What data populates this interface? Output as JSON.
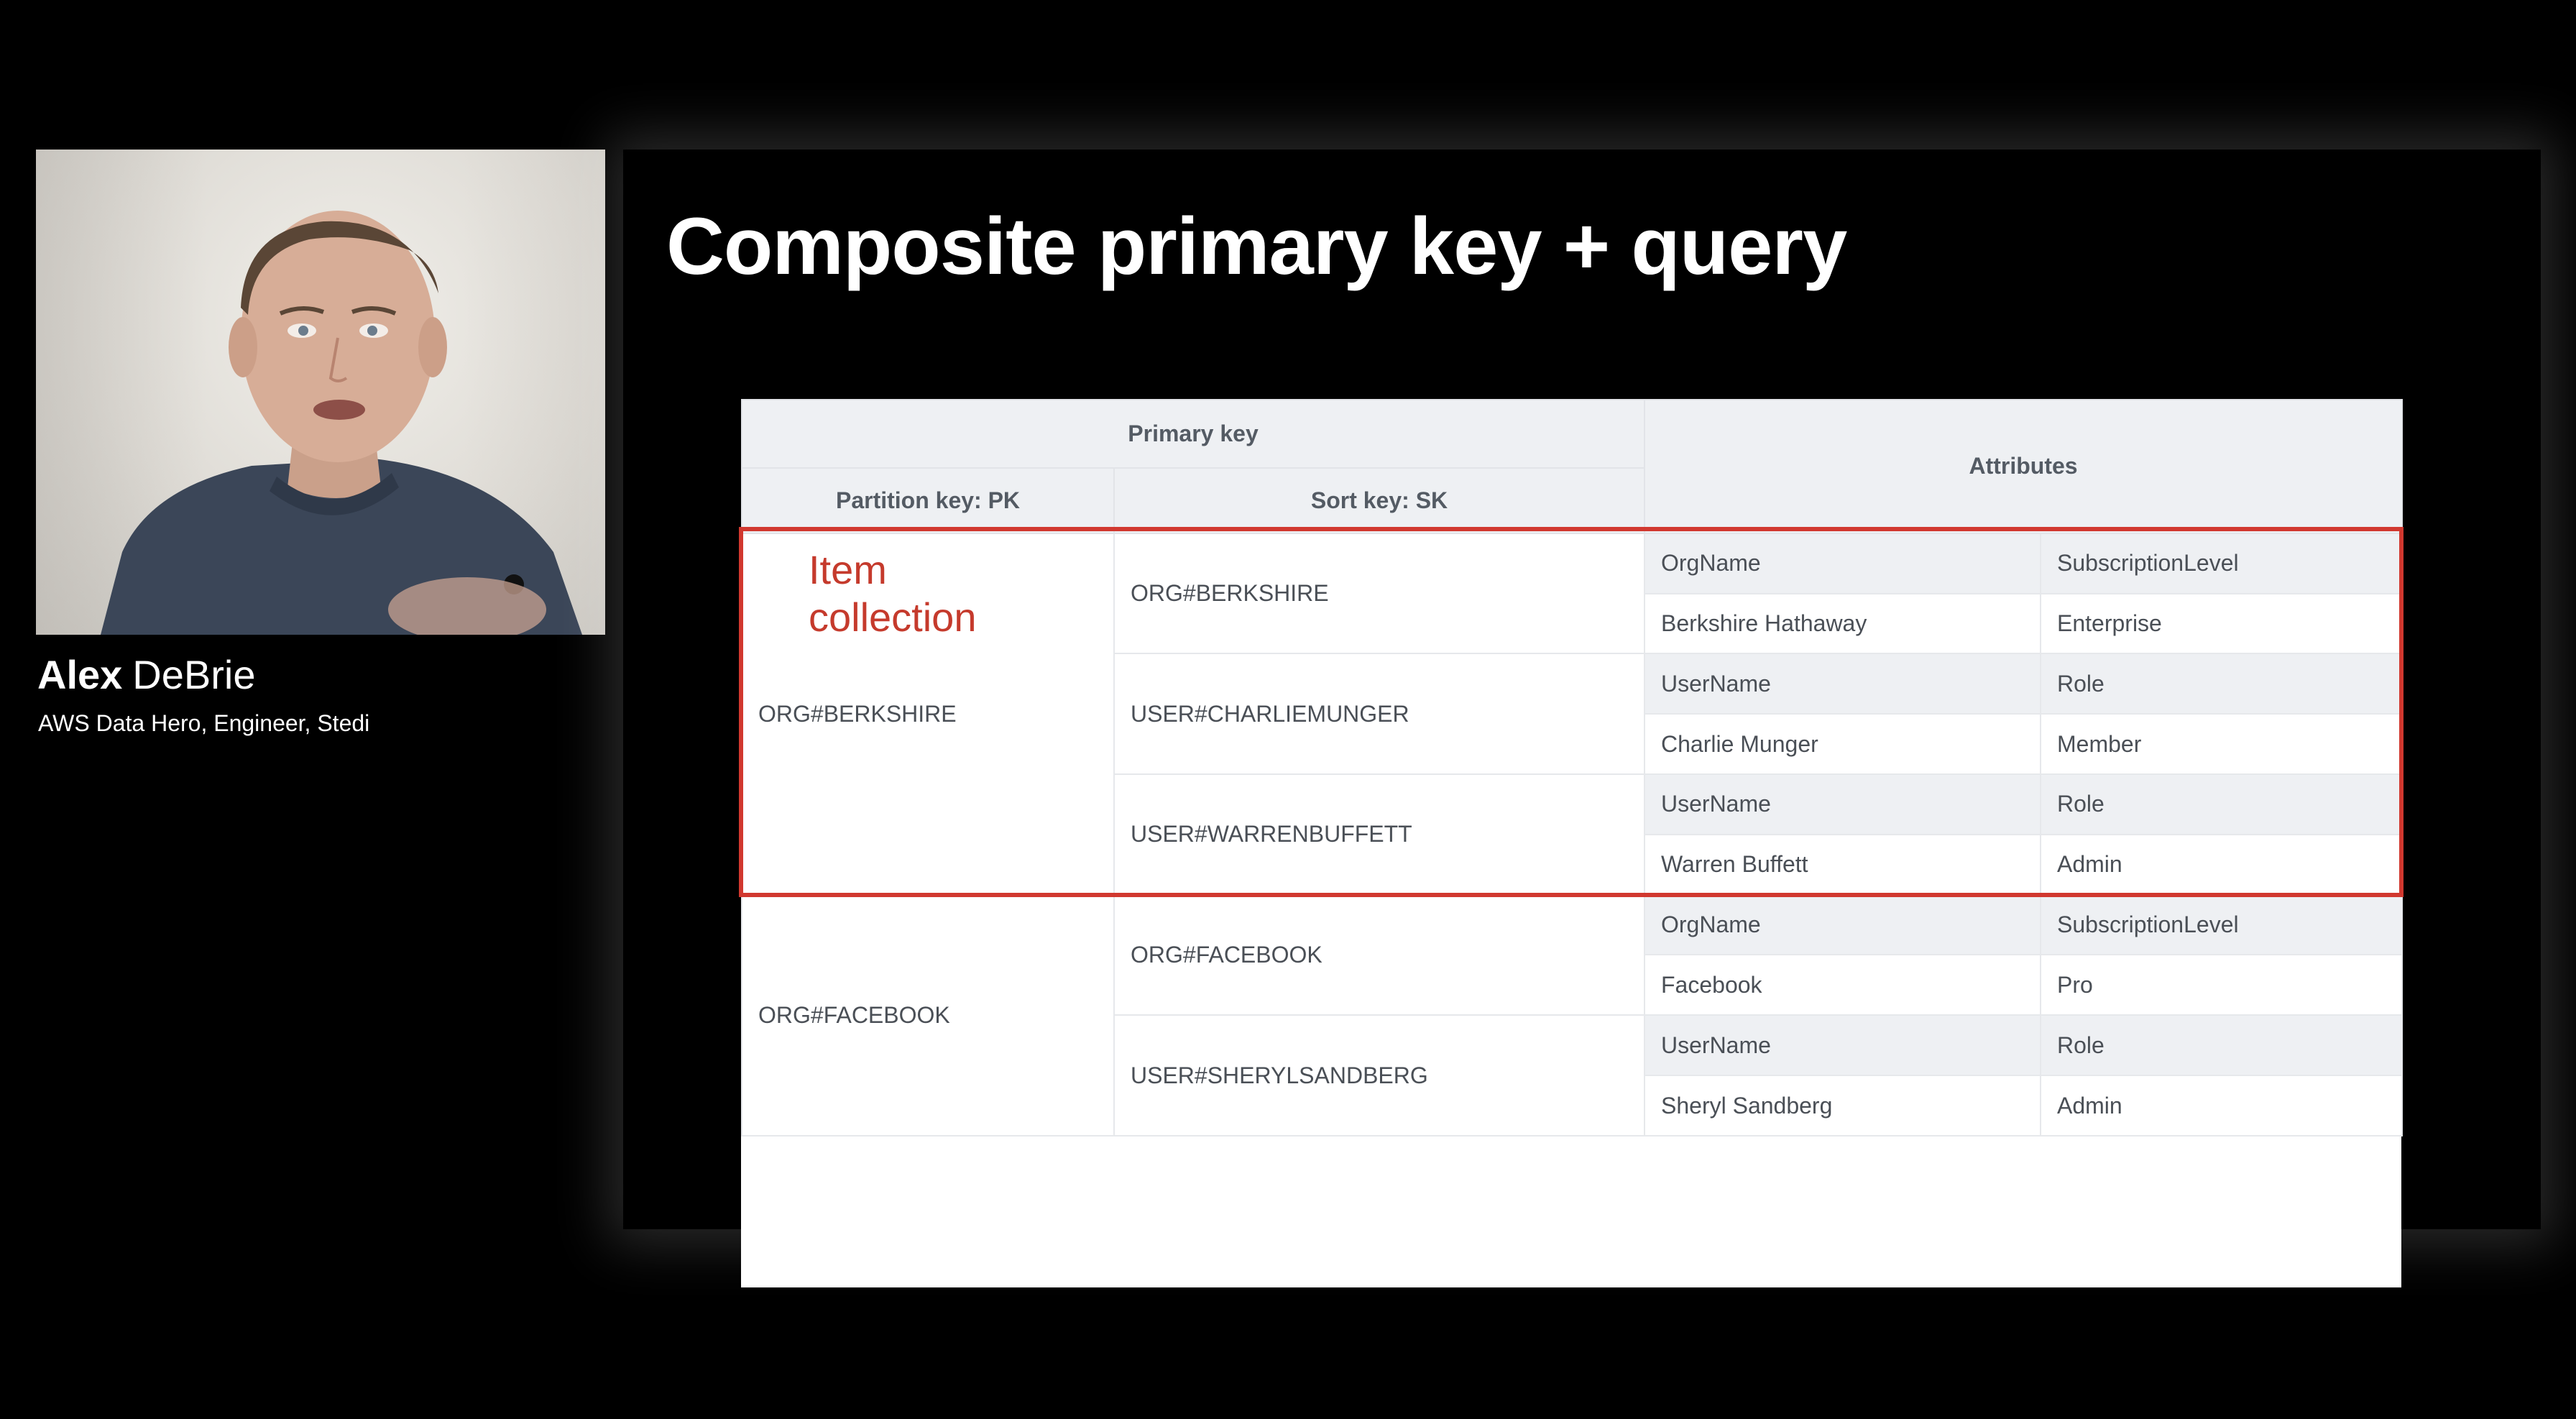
{
  "speaker": {
    "first_name": "Alex",
    "last_name": "DeBrie",
    "title": "AWS Data Hero, Engineer, Stedi"
  },
  "slide": {
    "title": "Composite primary key + query",
    "annotation": "Item\ncollection",
    "table": {
      "headers": {
        "primary_key": "Primary key",
        "partition_key": "Partition key: PK",
        "sort_key": "Sort key: SK",
        "attributes": "Attributes"
      },
      "items": [
        {
          "pk": "ORG#BERKSHIRE",
          "rows": [
            {
              "sk": "ORG#BERKSHIRE",
              "attr_names": [
                "OrgName",
                "SubscriptionLevel"
              ],
              "attr_values": [
                "Berkshire Hathaway",
                "Enterprise"
              ]
            },
            {
              "sk": "USER#CHARLIEMUNGER",
              "attr_names": [
                "UserName",
                "Role"
              ],
              "attr_values": [
                "Charlie Munger",
                "Member"
              ]
            },
            {
              "sk": "USER#WARRENBUFFETT",
              "attr_names": [
                "UserName",
                "Role"
              ],
              "attr_values": [
                "Warren Buffett",
                "Admin"
              ]
            }
          ]
        },
        {
          "pk": "ORG#FACEBOOK",
          "rows": [
            {
              "sk": "ORG#FACEBOOK",
              "attr_names": [
                "OrgName",
                "SubscriptionLevel"
              ],
              "attr_values": [
                "Facebook",
                "Pro"
              ]
            },
            {
              "sk": "USER#SHERYLSANDBERG",
              "attr_names": [
                "UserName",
                "Role"
              ],
              "attr_values": [
                "Sheryl Sandberg",
                "Admin"
              ]
            }
          ]
        }
      ]
    }
  },
  "colors": {
    "highlight": "#d1382f",
    "header_bg": "#eef0f3",
    "text": "#4a4f56"
  }
}
